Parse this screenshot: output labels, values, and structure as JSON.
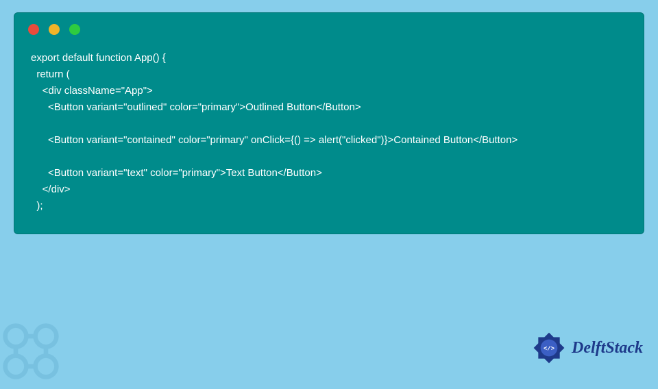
{
  "window": {
    "dots": [
      "red",
      "yellow",
      "green"
    ]
  },
  "code": {
    "lines": [
      "export default function App() {",
      "  return (",
      "    <div className=\"App\">",
      "      <Button variant=\"outlined\" color=\"primary\">Outlined Button</Button>",
      "",
      "      <Button variant=\"contained\" color=\"primary\" onClick={() => alert(\"clicked\")}>Contained Button</Button>",
      "",
      "      <Button variant=\"text\" color=\"primary\">Text Button</Button>",
      "    </div>",
      "  );"
    ]
  },
  "brand": {
    "name": "DelftStack"
  },
  "colors": {
    "background": "#87ceeb",
    "codeBg": "#008b8b",
    "codeText": "#ffffff",
    "brandText": "#1e3a8a"
  }
}
